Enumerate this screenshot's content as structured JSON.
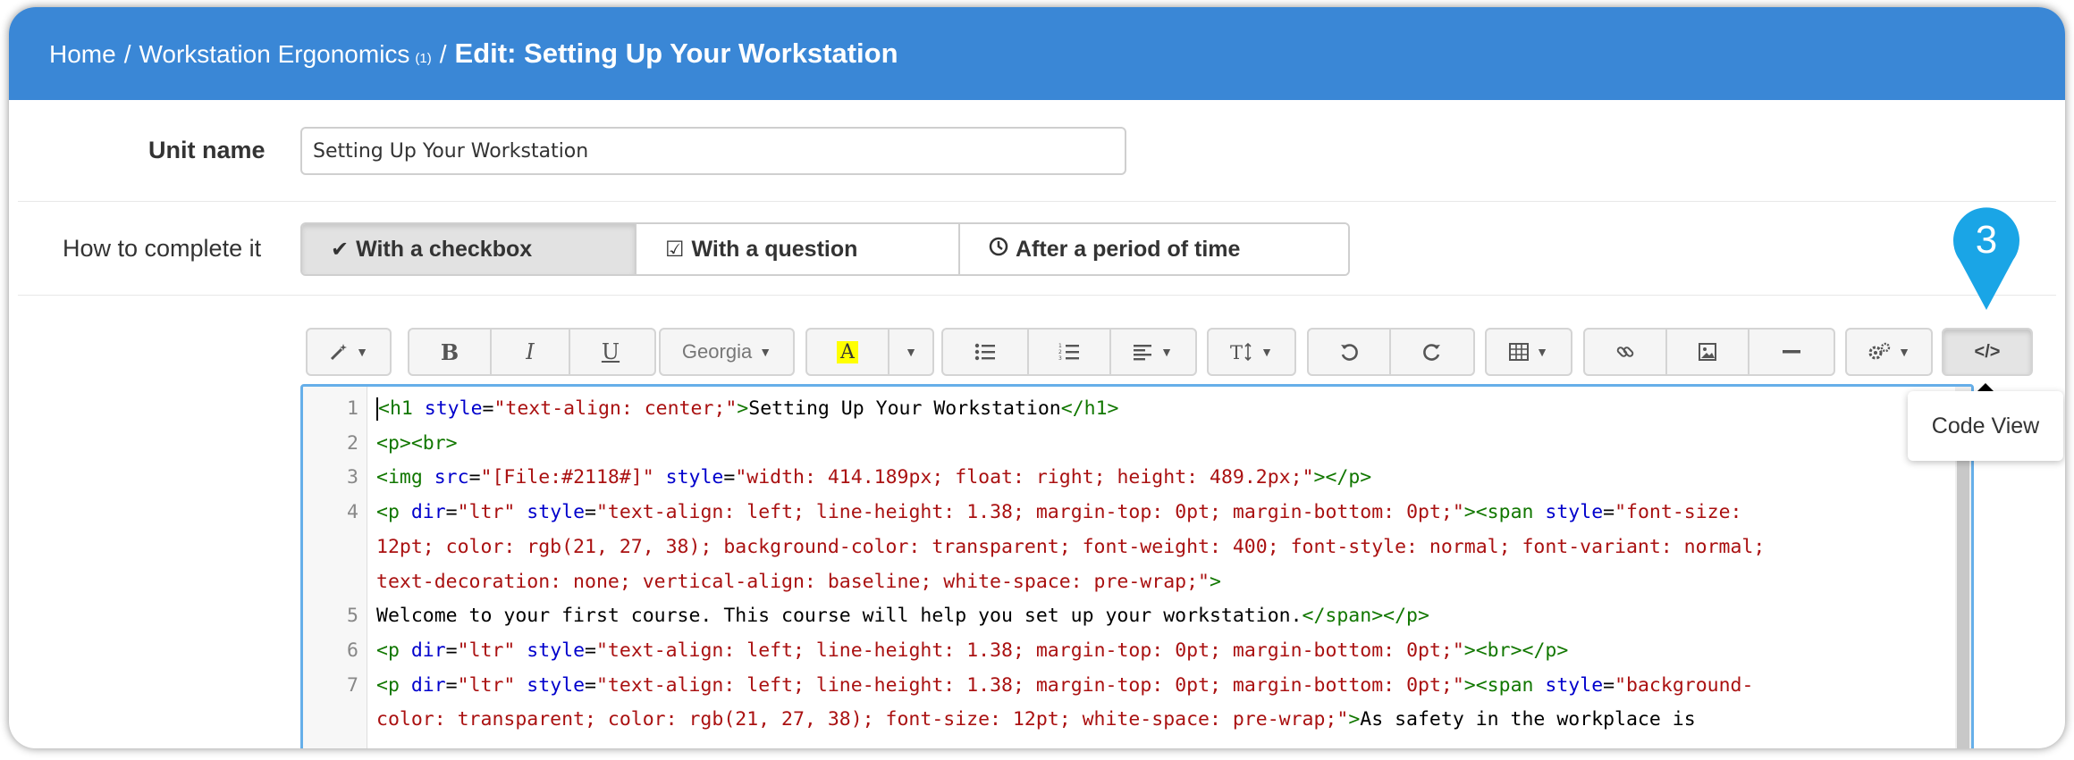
{
  "colors": {
    "header": "#3a87d6",
    "marker": "#1aa5e6",
    "editor_focus": "#66afe9"
  },
  "breadcrumb": {
    "home": "Home",
    "sep1": "/",
    "course": "Workstation Ergonomics",
    "course_count": "(1)",
    "sep2": "/",
    "current": "Edit: Setting Up Your Workstation"
  },
  "unit_name": {
    "label": "Unit name",
    "value": "Setting Up Your Workstation"
  },
  "completion": {
    "label": "How to complete it",
    "options": [
      {
        "label": "With a checkbox",
        "icon": "check-icon",
        "active": true
      },
      {
        "label": "With a question",
        "icon": "checkbox-icon",
        "active": false
      },
      {
        "label": "After a period of time",
        "icon": "clock-icon",
        "active": false
      }
    ]
  },
  "toolbar": {
    "magic": "magic-wand-icon",
    "bold": "B",
    "italic": "I",
    "underline": "U",
    "font": "Georgia",
    "highlight": "A",
    "code_view_icon": "</>"
  },
  "marker": {
    "number": "3"
  },
  "tooltip": {
    "text": "Code View"
  },
  "code": {
    "line_numbers": [
      "1",
      "2",
      "3",
      "4",
      "",
      "",
      "5",
      "6",
      "7",
      ""
    ],
    "l1": {
      "open": "<h1",
      "attr": " style",
      "eq": "=",
      "val": "\"text-align: center;\"",
      "close": ">",
      "text": "Setting Up Your Workstation",
      "end": "</h1>"
    },
    "l2": {
      "tags": "<p><br>"
    },
    "l3": {
      "open": "<img",
      "a1": " src",
      "eq1": "=",
      "v1": "\"[File:#2118#]\"",
      "a2": " style",
      "eq2": "=",
      "v2": "\"width: 414.189px; float: right; height: 489.2px;\"",
      "end": "></p>"
    },
    "l4a": {
      "open": "<p",
      "a1": " dir",
      "eq1": "=",
      "v1": "\"ltr\"",
      "a2": " style",
      "eq2": "=",
      "v2": "\"text-align: left; line-height: 1.38; margin-top: 0pt; margin-bottom: 0pt;\"",
      "mid": "><span",
      "a3": " style",
      "eq3": "=",
      "v3": "\"font-size:"
    },
    "l4b": {
      "v": "12pt; color: rgb(21, 27, 38); background-color: transparent; font-weight: 400; font-style: normal; font-variant: normal;"
    },
    "l4c": {
      "v": "text-decoration: none; vertical-align: baseline; white-space: pre-wrap;\"",
      "end": ">"
    },
    "l5": {
      "text": "Welcome to your first course. This course will help you set up your workstation.",
      "end": "</span></p>"
    },
    "l6": {
      "open": "<p",
      "a1": " dir",
      "eq1": "=",
      "v1": "\"ltr\"",
      "a2": " style",
      "eq2": "=",
      "v2": "\"text-align: left; line-height: 1.38; margin-top: 0pt; margin-bottom: 0pt;\"",
      "end": "><br></p>"
    },
    "l7a": {
      "open": "<p",
      "a1": " dir",
      "eq1": "=",
      "v1": "\"ltr\"",
      "a2": " style",
      "eq2": "=",
      "v2": "\"text-align: left; line-height: 1.38; margin-top: 0pt; margin-bottom: 0pt;\"",
      "mid": "><span",
      "a3": " style",
      "eq3": "=",
      "v3": "\"background-"
    },
    "l7b": {
      "v": "color: transparent; color: rgb(21, 27, 38); font-size: 12pt; white-space: pre-wrap;\"",
      "mid": ">",
      "text": "As safety in the workplace is"
    }
  }
}
